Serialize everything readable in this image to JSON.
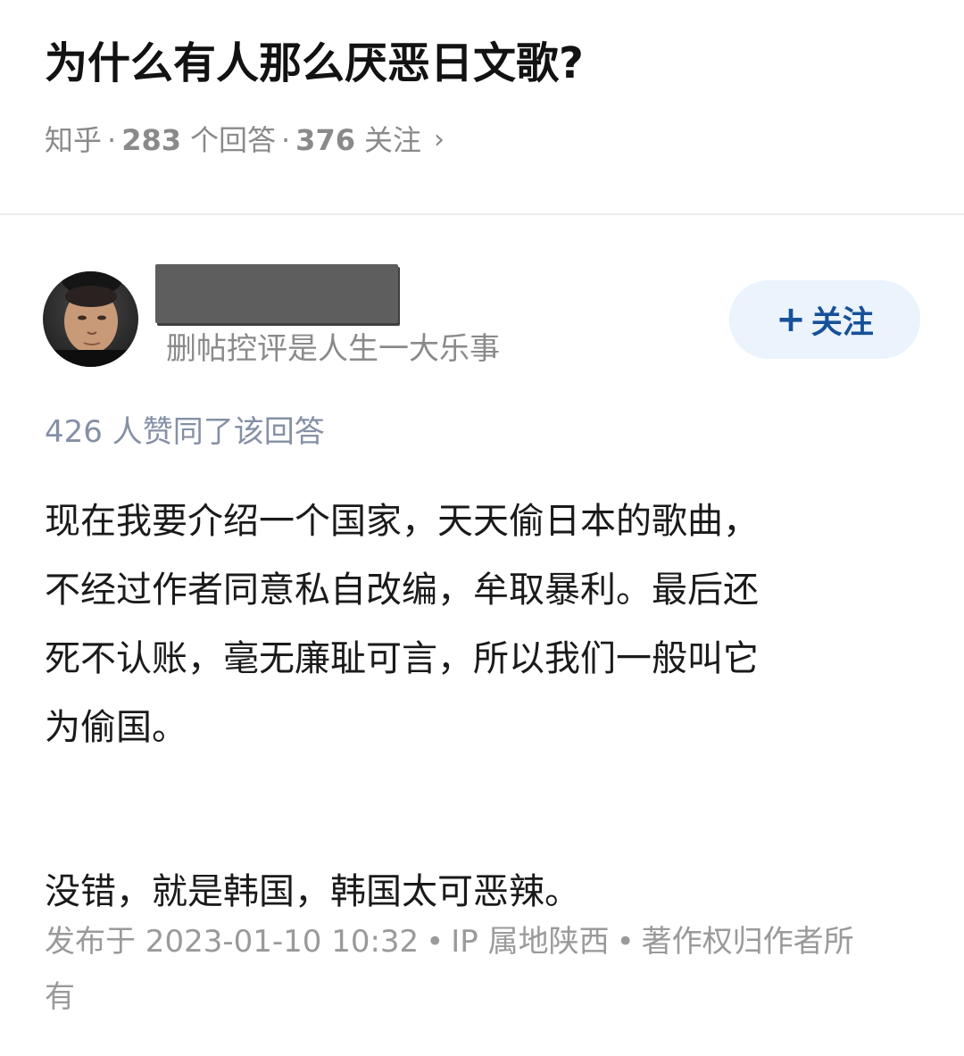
{
  "question": {
    "title": "为什么有人那么厌恶日文歌?",
    "source": "知乎",
    "answer_count": "283",
    "answer_label": "个回答",
    "follower_count": "376",
    "follower_label": "关注",
    "separator": "·",
    "chevron": "›"
  },
  "author": {
    "avatar_icon": "user-avatar-photo",
    "bio": "删帖控评是人生一大乐事",
    "follow_plus": "+",
    "follow_label": "关注"
  },
  "answer": {
    "votes_text": "426 人赞同了该回答",
    "paragraph1_lines": [
      "现在我要介绍一个国家，天天偷日本的歌曲，",
      "不经过作者同意私自改编，牟取暴利。最后还",
      "死不认账，毫无廉耻可言，所以我们一般叫它",
      "为偷国。"
    ],
    "paragraph2": "没错，就是韩国，韩国太可恶辣。"
  },
  "meta": {
    "published": "发布于 2023-01-10 10:32",
    "ip": "IP 属地陕西",
    "copyright_line1": "著作权归作者所",
    "copyright_line2": "有",
    "dot": "•"
  },
  "colors": {
    "meta_gray": "#8a8a8a",
    "vote_gray": "#8590a6",
    "follow_bg": "#ebf3fc",
    "follow_text": "#175199"
  }
}
